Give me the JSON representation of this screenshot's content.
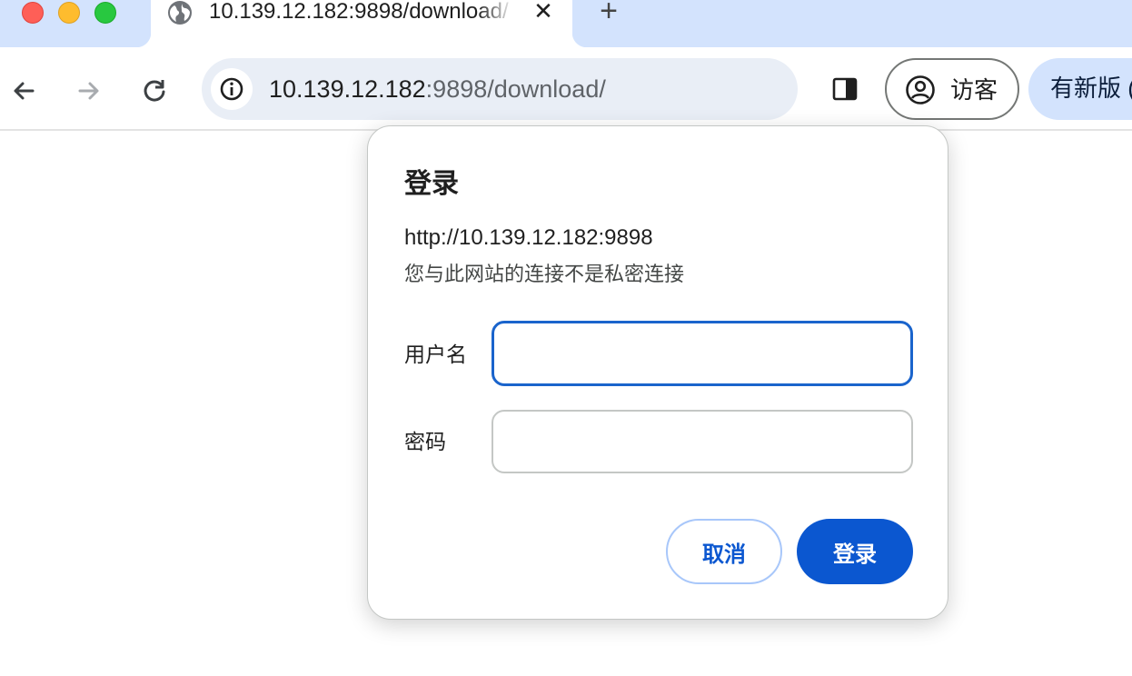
{
  "tab": {
    "title": "10.139.12.182:9898/download/",
    "close_glyph": "✕",
    "favicon": "globe-icon"
  },
  "tabstrip": {
    "new_tab_glyph": "+"
  },
  "toolbar": {
    "back_icon": "arrow-left-icon",
    "forward_icon": "arrow-right-icon",
    "reload_icon": "reload-icon",
    "url_host": "10.139.12.182",
    "url_rest": ":9898/download/",
    "site_info_icon": "info-icon",
    "side_panel_icon": "side-panel-icon",
    "profile_label": "访客",
    "update_label": "有新版 ("
  },
  "dialog": {
    "title": "登录",
    "origin": "http://10.139.12.182:9898",
    "warning": "您与此网站的连接不是私密连接",
    "username_label": "用户名",
    "username_value": "",
    "password_label": "密码",
    "password_value": "",
    "cancel_label": "取消",
    "submit_label": "登录"
  },
  "colors": {
    "tabstrip_bg": "#d3e3fd",
    "omnibox_bg": "#e9eef6",
    "primary_button": "#0b57d0",
    "focus_border": "#1a64cc"
  }
}
